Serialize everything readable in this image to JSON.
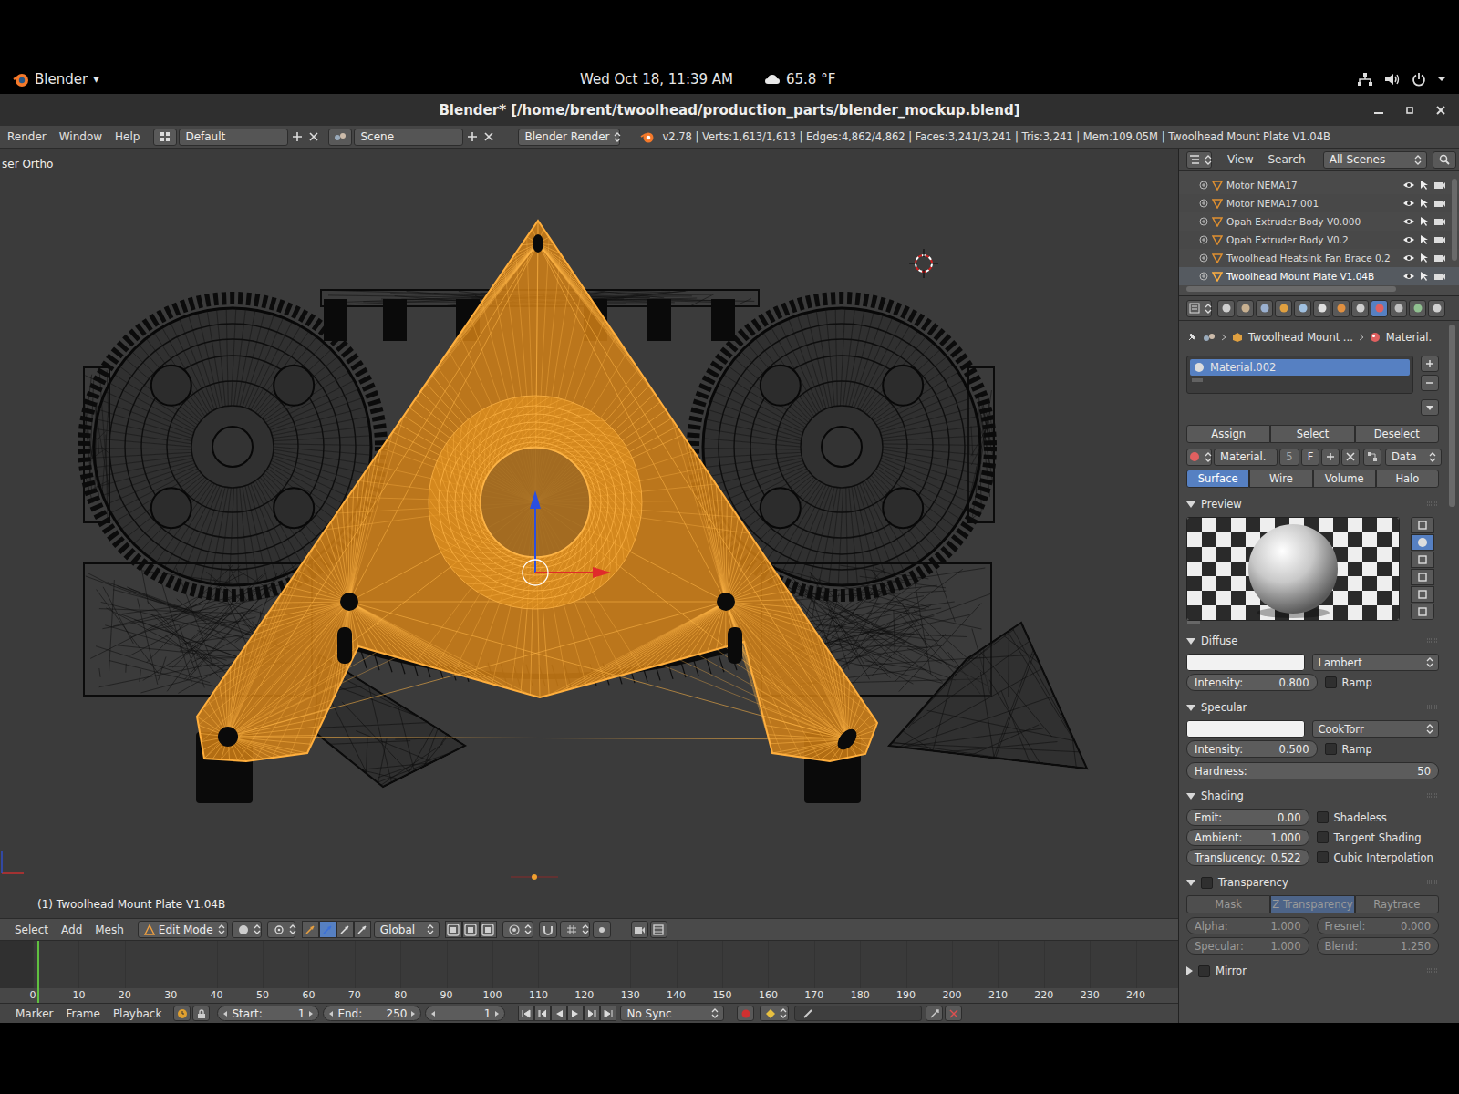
{
  "topbar": {
    "app": "Blender",
    "app_arrow": "▾",
    "clock": "Wed Oct 18, 11:39 AM",
    "weather": "65.8 °F"
  },
  "window": {
    "title": "Blender* [/home/brent/twoolhead/production_parts/blender_mockup.blend]"
  },
  "info_header": {
    "menus": [
      "Render",
      "Window",
      "Help"
    ],
    "layout": "Default",
    "scene": "Scene",
    "engine": "Blender Render",
    "stats": "v2.78 | Verts:1,613/1,613 | Edges:4,862/4,862 | Faces:3,241/3,241 | Tris:3,241 | Mem:109.05M | Twoolhead Mount Plate V1.04B"
  },
  "viewport": {
    "view_name": "ser Ortho",
    "object_name": "(1) Twoolhead Mount Plate V1.04B"
  },
  "view3d_header": {
    "menus": [
      "Select",
      "Add",
      "Mesh"
    ],
    "mode": "Edit Mode",
    "orientation": "Global"
  },
  "timeline": {
    "ticks": [
      "0",
      "10",
      "20",
      "30",
      "40",
      "50",
      "60",
      "70",
      "80",
      "90",
      "100",
      "110",
      "120",
      "130",
      "140",
      "150",
      "160",
      "170",
      "180",
      "190",
      "200",
      "210",
      "220",
      "230",
      "240"
    ],
    "menus": [
      "Marker",
      "Frame",
      "Playback"
    ],
    "start_label": "Start:",
    "start": "1",
    "end_label": "End:",
    "end": "250",
    "frame": "1",
    "sync": "No Sync"
  },
  "outliner": {
    "menus": [
      "View",
      "Search"
    ],
    "filter": "All Scenes",
    "items": [
      {
        "name": "Motor NEMA17",
        "selected": false
      },
      {
        "name": "Motor NEMA17.001",
        "selected": false
      },
      {
        "name": "Opah Extruder Body V0.000",
        "selected": false
      },
      {
        "name": "Opah Extruder Body V0.2",
        "selected": false
      },
      {
        "name": "Twoolhead Heatsink Fan Brace 0.2",
        "selected": false
      },
      {
        "name": "Twoolhead Mount Plate V1.04B",
        "selected": true
      }
    ]
  },
  "properties": {
    "context_tabs": [
      {
        "selected": false
      },
      {
        "selected": false
      },
      {
        "selected": false
      },
      {
        "selected": false
      },
      {
        "selected": false
      },
      {
        "selected": false
      },
      {
        "selected": false
      },
      {
        "selected": false
      },
      {
        "selected": true
      },
      {
        "selected": false
      },
      {
        "selected": false
      },
      {
        "selected": false
      }
    ],
    "breadcrumb": [
      "Twoolhead Mount ...",
      "Material."
    ],
    "slots": [
      {
        "name": "Material.002",
        "selected": true
      }
    ],
    "slot_buttons": [
      "Assign",
      "Select",
      "Deselect"
    ],
    "datablock": {
      "name": "Material.",
      "users": "5",
      "fake_user": "F",
      "link": "Data"
    },
    "modes": [
      {
        "label": "Surface",
        "selected": true
      },
      {
        "label": "Wire",
        "selected": false
      },
      {
        "label": "Volume",
        "selected": false
      },
      {
        "label": "Halo",
        "selected": false
      }
    ],
    "preview": {
      "title": "Preview",
      "expanded": true,
      "types": [
        {
          "selected": false
        },
        {
          "selected": true
        },
        {
          "selected": false
        },
        {
          "selected": false
        },
        {
          "selected": false
        },
        {
          "selected": false
        }
      ]
    },
    "diffuse": {
      "title": "Diffuse",
      "expanded": true,
      "shader": "Lambert",
      "intensity": {
        "label": "Intensity:",
        "value": "0.800"
      },
      "ramp": {
        "label": "Ramp",
        "checked": false
      }
    },
    "specular": {
      "title": "Specular",
      "expanded": true,
      "shader": "CookTorr",
      "intensity": {
        "label": "Intensity:",
        "value": "0.500"
      },
      "ramp": {
        "label": "Ramp",
        "checked": false
      },
      "hardness": {
        "label": "Hardness:",
        "value": "50"
      }
    },
    "shading": {
      "title": "Shading",
      "expanded": true,
      "fields": [
        {
          "label": "Emit:",
          "value": "0.00"
        },
        {
          "label": "Ambient:",
          "value": "1.000"
        },
        {
          "label": "Translucency:",
          "value": "0.522"
        }
      ],
      "checks": [
        {
          "label": "Shadeless",
          "checked": false
        },
        {
          "label": "Tangent Shading",
          "checked": false
        },
        {
          "label": "Cubic Interpolation",
          "checked": false
        }
      ]
    },
    "transparency": {
      "title": "Transparency",
      "expanded": true,
      "enabled": false,
      "methods": [
        {
          "label": "Mask",
          "selected": false
        },
        {
          "label": "Z Transparency",
          "selected": true
        },
        {
          "label": "Raytrace",
          "selected": false
        }
      ],
      "fields": [
        {
          "label": "Alpha:",
          "value": "1.000"
        },
        {
          "label": "Fresnel:",
          "value": "0.000"
        },
        {
          "label": "Specular:",
          "value": "1.000"
        },
        {
          "label": "Blend:",
          "value": "1.250"
        }
      ]
    },
    "mirror": {
      "title": "Mirror",
      "expanded": false,
      "enabled": false
    }
  }
}
